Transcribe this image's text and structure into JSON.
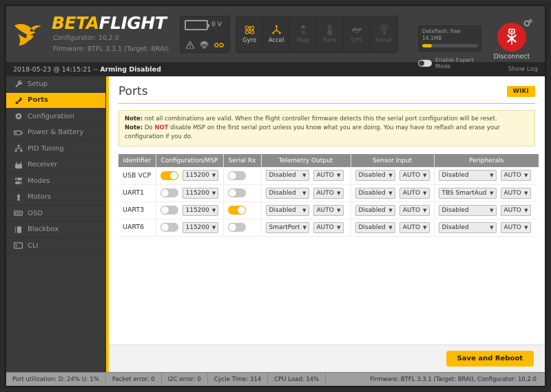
{
  "app": {
    "brand_beta": "BETA",
    "brand_flight": "FLIGHT",
    "configurator_line": "Configurator: 10.2.0",
    "firmware_line": "Firmware: BTFL 3.3.1 (Target: BRAI)"
  },
  "header": {
    "battery_voltage": "0 V",
    "sensors": [
      {
        "label": "Gyro",
        "icon": "gyro-icon",
        "active": true
      },
      {
        "label": "Accel",
        "icon": "accel-icon",
        "active": true
      },
      {
        "label": "Mag",
        "icon": "mag-icon",
        "active": false
      },
      {
        "label": "Baro",
        "icon": "baro-icon",
        "active": false
      },
      {
        "label": "GPS",
        "icon": "gps-icon",
        "active": false
      },
      {
        "label": "Sonar",
        "icon": "sonar-icon",
        "active": false
      }
    ],
    "dataflash_label": "Dataflash: free 14.1MB",
    "dataflash_percent": 17,
    "expert_mode_label": "Enable Expert Mode",
    "expert_mode_on": false,
    "disconnect_label": "Disconnect",
    "icons": {
      "warning": "warning-icon",
      "failsafe": "parachute-icon",
      "link": "link-icon",
      "settings": "gear-icon",
      "usb": "usb-disconnect-icon"
    },
    "colors": {
      "accent": "#ffbb00",
      "danger": "#d61f1f"
    }
  },
  "status_strip": {
    "timestamp": "2018-05-23 @ 14:15:21 -- ",
    "state": "Arming Disabled",
    "show_log": "Show Log"
  },
  "sidebar": {
    "items": [
      {
        "label": "Setup",
        "icon": "wrench-icon",
        "active": false
      },
      {
        "label": "Ports",
        "icon": "plug-icon",
        "active": true
      },
      {
        "label": "Configuration",
        "icon": "gear-icon",
        "active": false
      },
      {
        "label": "Power & Battery",
        "icon": "battery-icon",
        "active": false
      },
      {
        "label": "PID Tuning",
        "icon": "sliders-icon",
        "active": false
      },
      {
        "label": "Receiver",
        "icon": "radio-icon",
        "active": false
      },
      {
        "label": "Modes",
        "icon": "modes-icon",
        "active": false
      },
      {
        "label": "Motors",
        "icon": "motor-icon",
        "active": false
      },
      {
        "label": "OSD",
        "icon": "osd-icon",
        "active": false
      },
      {
        "label": "Blackbox",
        "icon": "blackbox-icon",
        "active": false
      },
      {
        "label": "CLI",
        "icon": "terminal-icon",
        "active": false
      }
    ]
  },
  "main": {
    "title": "Ports",
    "wiki_label": "WIKI",
    "notes": [
      {
        "prefix": "Note:",
        "text": " not all combinations are valid. When the flight controller firmware detects this the serial port configuration will be reset."
      },
      {
        "prefix": "Note:",
        "pre": " Do ",
        "emphasis": "NOT",
        "post": " disable MSP on the first serial port unless you know what you are doing. You may have to reflash and erase your configuration if you do."
      }
    ],
    "table": {
      "headers": [
        "Identifier",
        "Configuration/MSP",
        "Serial Rx",
        "Telemetry Output",
        "Sensor Input",
        "Peripherals"
      ],
      "rows": [
        {
          "identifier": "USB VCP",
          "msp_on": true,
          "baud": "115200",
          "serial_rx_on": false,
          "telemetry": "Disabled",
          "telemetry_baud": "AUTO",
          "sensor": "Disabled",
          "sensor_baud": "AUTO",
          "peripheral": "Disabled",
          "peripheral_baud": "AUTO"
        },
        {
          "identifier": "UART1",
          "msp_on": false,
          "baud": "115200",
          "serial_rx_on": false,
          "telemetry": "Disabled",
          "telemetry_baud": "AUTO",
          "sensor": "Disabled",
          "sensor_baud": "AUTO",
          "peripheral": "TBS SmartAud",
          "peripheral_baud": "AUTO"
        },
        {
          "identifier": "UART3",
          "msp_on": false,
          "baud": "115200",
          "serial_rx_on": true,
          "telemetry": "Disabled",
          "telemetry_baud": "AUTO",
          "sensor": "Disabled",
          "sensor_baud": "AUTO",
          "peripheral": "Disabled",
          "peripheral_baud": "AUTO"
        },
        {
          "identifier": "UART6",
          "msp_on": false,
          "baud": "115200",
          "serial_rx_on": false,
          "telemetry": "SmartPort",
          "telemetry_baud": "AUTO",
          "sensor": "Disabled",
          "sensor_baud": "AUTO",
          "peripheral": "Disabled",
          "peripheral_baud": "AUTO"
        }
      ]
    },
    "save_label": "Save and Reboot"
  },
  "bottom_bar": {
    "cells": [
      "Port utilization: D: 24% U: 1%",
      "Packet error: 0",
      "I2C error: 0",
      "Cycle Time: 314",
      "CPU Load: 14%"
    ],
    "right": "Firmware: BTFL 3.3.1 (Target: BRAI), Configurator: 10.2.0"
  }
}
